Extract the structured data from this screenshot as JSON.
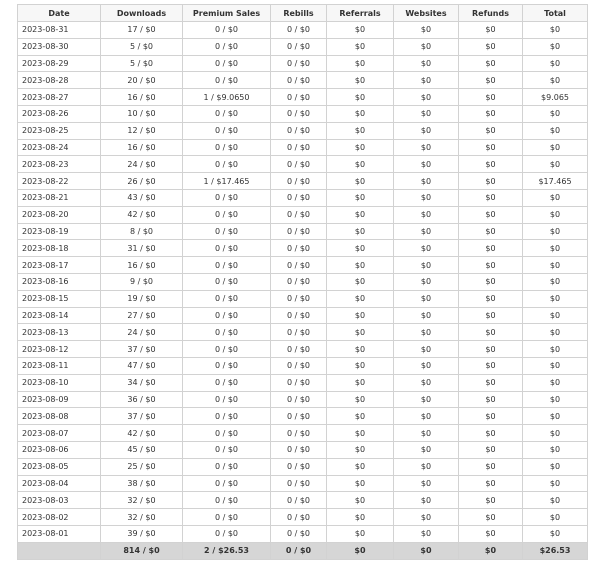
{
  "columns": [
    "Date",
    "Downloads",
    "Premium Sales",
    "Rebills",
    "Referrals",
    "Websites",
    "Refunds",
    "Total"
  ],
  "rows": [
    [
      "2023-08-31",
      "17 / $0",
      "0 / $0",
      "0 / $0",
      "$0",
      "$0",
      "$0",
      "$0"
    ],
    [
      "2023-08-30",
      "5 / $0",
      "0 / $0",
      "0 / $0",
      "$0",
      "$0",
      "$0",
      "$0"
    ],
    [
      "2023-08-29",
      "5 / $0",
      "0 / $0",
      "0 / $0",
      "$0",
      "$0",
      "$0",
      "$0"
    ],
    [
      "2023-08-28",
      "20 / $0",
      "0 / $0",
      "0 / $0",
      "$0",
      "$0",
      "$0",
      "$0"
    ],
    [
      "2023-08-27",
      "16 / $0",
      "1 / $9.0650",
      "0 / $0",
      "$0",
      "$0",
      "$0",
      "$9.065"
    ],
    [
      "2023-08-26",
      "10 / $0",
      "0 / $0",
      "0 / $0",
      "$0",
      "$0",
      "$0",
      "$0"
    ],
    [
      "2023-08-25",
      "12 / $0",
      "0 / $0",
      "0 / $0",
      "$0",
      "$0",
      "$0",
      "$0"
    ],
    [
      "2023-08-24",
      "16 / $0",
      "0 / $0",
      "0 / $0",
      "$0",
      "$0",
      "$0",
      "$0"
    ],
    [
      "2023-08-23",
      "24 / $0",
      "0 / $0",
      "0 / $0",
      "$0",
      "$0",
      "$0",
      "$0"
    ],
    [
      "2023-08-22",
      "26 / $0",
      "1 / $17.465",
      "0 / $0",
      "$0",
      "$0",
      "$0",
      "$17.465"
    ],
    [
      "2023-08-21",
      "43 / $0",
      "0 / $0",
      "0 / $0",
      "$0",
      "$0",
      "$0",
      "$0"
    ],
    [
      "2023-08-20",
      "42 / $0",
      "0 / $0",
      "0 / $0",
      "$0",
      "$0",
      "$0",
      "$0"
    ],
    [
      "2023-08-19",
      "8 / $0",
      "0 / $0",
      "0 / $0",
      "$0",
      "$0",
      "$0",
      "$0"
    ],
    [
      "2023-08-18",
      "31 / $0",
      "0 / $0",
      "0 / $0",
      "$0",
      "$0",
      "$0",
      "$0"
    ],
    [
      "2023-08-17",
      "16 / $0",
      "0 / $0",
      "0 / $0",
      "$0",
      "$0",
      "$0",
      "$0"
    ],
    [
      "2023-08-16",
      "9 / $0",
      "0 / $0",
      "0 / $0",
      "$0",
      "$0",
      "$0",
      "$0"
    ],
    [
      "2023-08-15",
      "19 / $0",
      "0 / $0",
      "0 / $0",
      "$0",
      "$0",
      "$0",
      "$0"
    ],
    [
      "2023-08-14",
      "27 / $0",
      "0 / $0",
      "0 / $0",
      "$0",
      "$0",
      "$0",
      "$0"
    ],
    [
      "2023-08-13",
      "24 / $0",
      "0 / $0",
      "0 / $0",
      "$0",
      "$0",
      "$0",
      "$0"
    ],
    [
      "2023-08-12",
      "37 / $0",
      "0 / $0",
      "0 / $0",
      "$0",
      "$0",
      "$0",
      "$0"
    ],
    [
      "2023-08-11",
      "47 / $0",
      "0 / $0",
      "0 / $0",
      "$0",
      "$0",
      "$0",
      "$0"
    ],
    [
      "2023-08-10",
      "34 / $0",
      "0 / $0",
      "0 / $0",
      "$0",
      "$0",
      "$0",
      "$0"
    ],
    [
      "2023-08-09",
      "36 / $0",
      "0 / $0",
      "0 / $0",
      "$0",
      "$0",
      "$0",
      "$0"
    ],
    [
      "2023-08-08",
      "37 / $0",
      "0 / $0",
      "0 / $0",
      "$0",
      "$0",
      "$0",
      "$0"
    ],
    [
      "2023-08-07",
      "42 / $0",
      "0 / $0",
      "0 / $0",
      "$0",
      "$0",
      "$0",
      "$0"
    ],
    [
      "2023-08-06",
      "45 / $0",
      "0 / $0",
      "0 / $0",
      "$0",
      "$0",
      "$0",
      "$0"
    ],
    [
      "2023-08-05",
      "25 / $0",
      "0 / $0",
      "0 / $0",
      "$0",
      "$0",
      "$0",
      "$0"
    ],
    [
      "2023-08-04",
      "38 / $0",
      "0 / $0",
      "0 / $0",
      "$0",
      "$0",
      "$0",
      "$0"
    ],
    [
      "2023-08-03",
      "32 / $0",
      "0 / $0",
      "0 / $0",
      "$0",
      "$0",
      "$0",
      "$0"
    ],
    [
      "2023-08-02",
      "32 / $0",
      "0 / $0",
      "0 / $0",
      "$0",
      "$0",
      "$0",
      "$0"
    ],
    [
      "2023-08-01",
      "39 / $0",
      "0 / $0",
      "0 / $0",
      "$0",
      "$0",
      "$0",
      "$0"
    ]
  ],
  "totals": [
    "",
    "814 / $0",
    "2 / $26.53",
    "0 / $0",
    "$0",
    "$0",
    "$0",
    "$26.53"
  ],
  "colors": {
    "header_bg": "#f7f7f7",
    "footer_bg": "#d6d6d6",
    "border": "#d2d2d2",
    "text": "#333333"
  }
}
